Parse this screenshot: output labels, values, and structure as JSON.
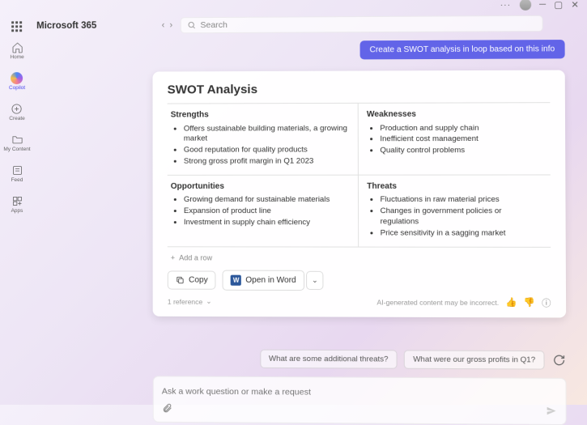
{
  "window": {
    "dots": "···"
  },
  "brand": "Microsoft 365",
  "search": {
    "placeholder": "Search"
  },
  "sidebar": {
    "items": [
      {
        "id": "home",
        "label": "Home"
      },
      {
        "id": "copilot",
        "label": "Copilot"
      },
      {
        "id": "create",
        "label": "Create"
      },
      {
        "id": "mycontent",
        "label": "My Content"
      },
      {
        "id": "feed",
        "label": "Feed"
      },
      {
        "id": "apps",
        "label": "Apps"
      }
    ]
  },
  "chat": {
    "user_message": "Create a SWOT analysis in loop based on this info",
    "swot": {
      "title": "SWOT Analysis",
      "strengths": {
        "heading": "Strengths",
        "items": [
          "Offers sustainable building materials, a growing market",
          "Good reputation for quality products",
          "Strong gross profit margin in Q1 2023"
        ]
      },
      "weaknesses": {
        "heading": "Weaknesses",
        "items": [
          "Production and supply chain",
          "Inefficient cost management",
          "Quality control problems"
        ]
      },
      "opportunities": {
        "heading": "Opportunities",
        "items": [
          "Growing demand for sustainable materials",
          "Expansion of product line",
          "Investment in supply chain efficiency"
        ]
      },
      "threats": {
        "heading": "Threats",
        "items": [
          "Fluctuations in raw material prices",
          "Changes in government policies or regulations",
          "Price sensitivity in a sagging market"
        ]
      }
    },
    "add_row": "Add a row",
    "actions": {
      "copy": "Copy",
      "open_word": "Open in Word"
    },
    "disclaimer": "AI-generated content may be incorrect.",
    "references": "1 reference",
    "suggestions": [
      "What are some additional threats?",
      "What were our gross profits in Q1?"
    ],
    "composer_placeholder": "Ask a work question or make a request"
  }
}
